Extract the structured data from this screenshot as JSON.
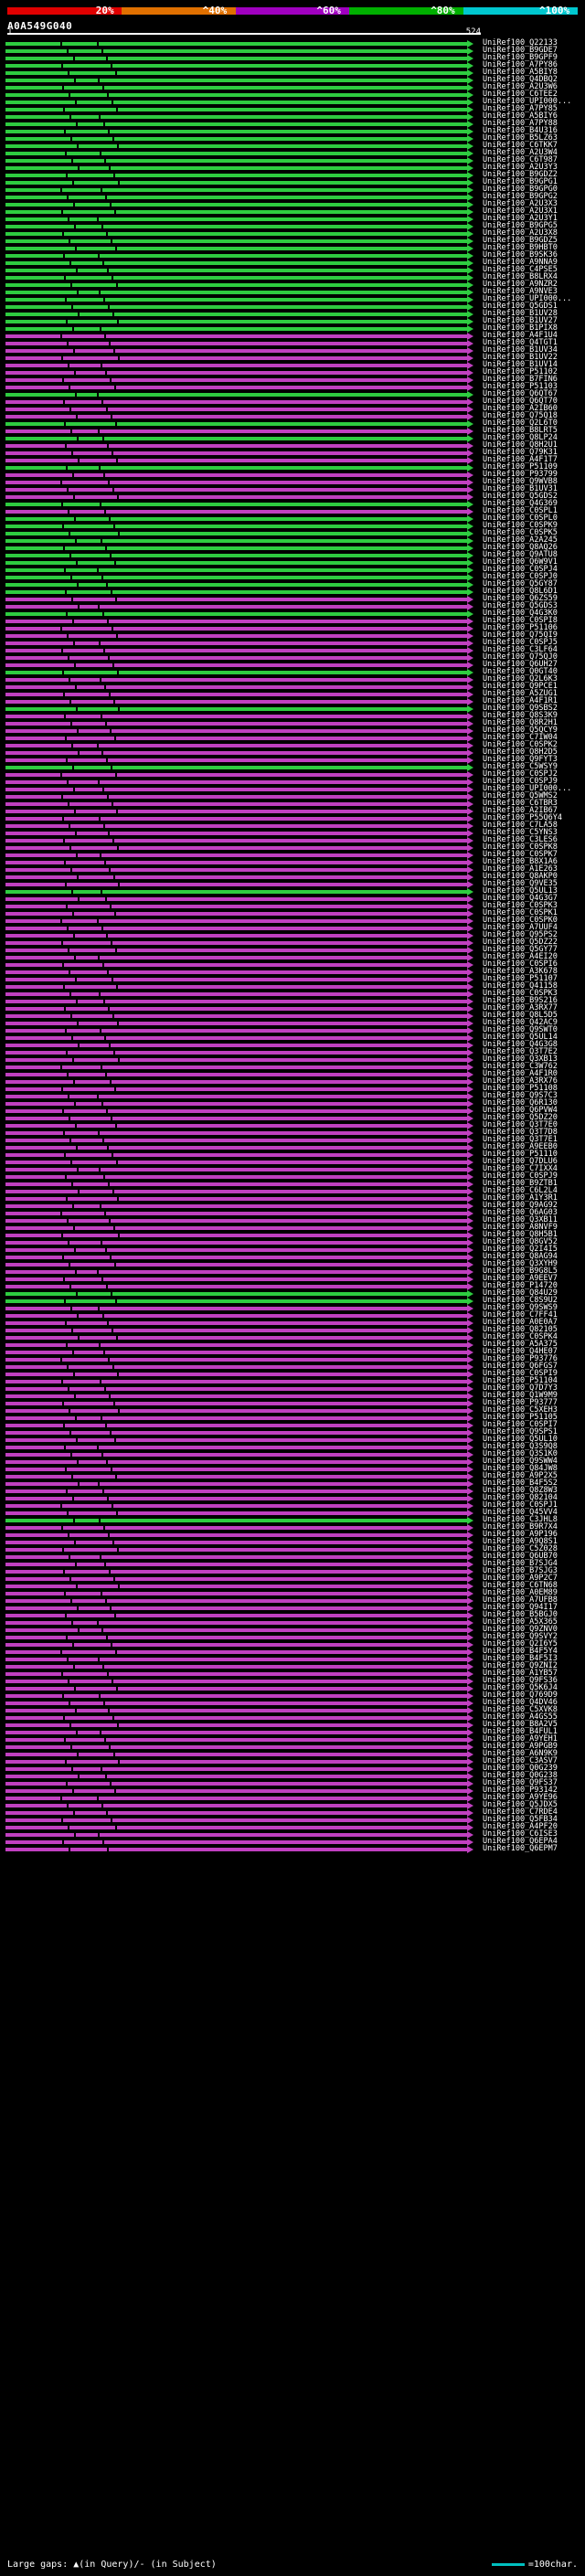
{
  "colors": {
    "seg1": "#e00000",
    "seg2": "#e07000",
    "seg3": "#a000c0",
    "seg4": "#00b000",
    "seg5": "#00c8d0",
    "bar_green": "#2ecc40",
    "bar_magenta": "#c040c0"
  },
  "legend": {
    "p20": "20%",
    "p40": "^40%",
    "p60": "^60%",
    "p80": "^80%",
    "p100": "^100%"
  },
  "query": {
    "name": "A0A549G040",
    "start": "1",
    "end": "524"
  },
  "footer": {
    "text": "Large gaps: ▲(in Query)/- (in Subject)",
    "scale_text": "=100char."
  },
  "hits": [
    "UniRef100_Q22133",
    "UniRef100_B9GDE7",
    "UniRef100_B9GPF9",
    "UniRef100_A7PY86",
    "UniRef100_A5BIY8",
    "UniRef100_Q4DBQ2",
    "UniRef100_A2U3W6",
    "UniRef100_C6TEE2",
    "UniRef100_UPI000...",
    "UniRef100_A7PY85",
    "UniRef100_A5BIY6",
    "UniRef100_A7PY88",
    "UniRef100_B4U316",
    "UniRef100_B5LZ63",
    "UniRef100_C6TKK7",
    "UniRef100_A2U3W4",
    "UniRef100_C6T987",
    "UniRef100_A2U3Y3",
    "UniRef100_B9GDZ2",
    "UniRef100_B9GPG1",
    "UniRef100_B9GPG0",
    "UniRef100_B9GPG2",
    "UniRef100_A2U3X3",
    "UniRef100_A2U3X1",
    "UniRef100_A2U3Y1",
    "UniRef100_B9GPG5",
    "UniRef100_A2U3X8",
    "UniRef100_B9GDZ5",
    "UniRef100_B9HBT0",
    "UniRef100_B9SK36",
    "UniRef100_A9NNA9",
    "UniRef100_C4PSE5",
    "UniRef100_B8LRX4",
    "UniRef100_A9NZR2",
    "UniRef100_A9NVE3",
    "UniRef100_UPI000...",
    "UniRef100_Q5GDS1",
    "UniRef100_B1UV28",
    "UniRef100_B1UV27",
    "UniRef100_B1PIX8",
    "UniRef100_A4F1U4",
    "UniRef100_Q4TGT1",
    "UniRef100_B1UV34",
    "UniRef100_B1UV22",
    "UniRef100_B1UV14",
    "UniRef100_P51102",
    "UniRef100_B7FIN6",
    "UniRef100_P51103",
    "UniRef100_Q6QT67",
    "UniRef100_Q6QT70",
    "UniRef100_A2IB60",
    "UniRef100_Q75Q18",
    "UniRef100_Q2L6T0",
    "UniRef100_B8LRT5",
    "UniRef100_Q8LP24",
    "UniRef100_Q8H2U1",
    "UniRef100_Q79K31",
    "UniRef100_A4F1T7",
    "UniRef100_P51109",
    "UniRef100_P93799",
    "UniRef100_Q9WVB8",
    "UniRef100_B1UV31",
    "UniRef100_Q5GDS2",
    "UniRef100_Q4G369",
    "UniRef100_C0SPL1",
    "UniRef100_C0SPL0",
    "UniRef100_C0SPK9",
    "UniRef100_C0SPK5",
    "UniRef100_A2A245",
    "UniRef100_Q8AQ26",
    "UniRef100_Q9ATU8",
    "UniRef100_Q6W9V1",
    "UniRef100_C0SPJ4",
    "UniRef100_C0SPJ0",
    "UniRef100_Q5GY87",
    "UniRef100_Q8L6D1",
    "UniRef100_Q6ZS59",
    "UniRef100_Q5GDS3",
    "UniRef100_Q4G3K0",
    "UniRef100_C0SPI8",
    "UniRef100_P51106",
    "UniRef100_Q75QI9",
    "UniRef100_C0SPJ5",
    "UniRef100_C3LF64",
    "UniRef100_Q75QJ0",
    "UniRef100_Q6UH27",
    "UniRef100_Q0GT40",
    "UniRef100_Q2L6K3",
    "UniRef100_Q9PCE1",
    "UniRef100_A5ZUG1",
    "UniRef100_A4F1R1",
    "UniRef100_Q9SBS2",
    "UniRef100_Q8S3K9",
    "UniRef100_Q8R2H1",
    "UniRef100_Q5QCY9",
    "UniRef100_C7IW04",
    "UniRef100_C0SPK2",
    "UniRef100_Q8H2D5",
    "UniRef100_Q9FYT3",
    "UniRef100_C5WSY9",
    "UniRef100_C0SPJ2",
    "UniRef100_C0SPJ9",
    "UniRef100_UPI000...",
    "UniRef100_Q5WMS2",
    "UniRef100_C6TBR3",
    "UniRef100_A2IB67",
    "UniRef100_P55Q6Y4",
    "UniRef100_C7LA58",
    "UniRef100_C5YNS3",
    "UniRef100_C3LES6",
    "UniRef100_C0SPK8",
    "UniRef100_C0SPK7",
    "UniRef100_B8X1A6",
    "UniRef100_A1E263",
    "UniRef100_Q8AKP0",
    "UniRef100_Q9VE35",
    "UniRef100_Q5UL13",
    "UniRef100_Q4G3G7",
    "UniRef100_C0SPK3",
    "UniRef100_C0SPK1",
    "UniRef100_C0SPK0",
    "UniRef100_A7UUF4",
    "UniRef100_Q95PS2",
    "UniRef100_Q5DZ22",
    "UniRef100_Q5GY77",
    "UniRef100_A4EI20",
    "UniRef100_C0SPI6",
    "UniRef100_A3K678",
    "UniRef100_P51107",
    "UniRef100_Q41158",
    "UniRef100_C0SPK3",
    "UniRef100_B9S216",
    "UniRef100_A3RX77",
    "UniRef100_Q8L5D5",
    "UniRef100_Q42AC9",
    "UniRef100_Q9SWT0",
    "UniRef100_Q5UL14",
    "UniRef100_Q4G3G8",
    "UniRef100_Q3T7E2",
    "UniRef100_Q3XB13",
    "UniRef100_C3W762",
    "UniRef100_A4F1R0",
    "UniRef100_A3RX76",
    "UniRef100_P51108",
    "UniRef100_Q9S7C3",
    "UniRef100_Q6R130",
    "UniRef100_Q6PVW4",
    "UniRef100_Q5DZ20",
    "UniRef100_Q3T7E0",
    "UniRef100_Q3T7D8",
    "UniRef100_Q3T7E1",
    "UniRef100_A9EEB0",
    "UniRef100_P51110",
    "UniRef100_Q7DLU6",
    "UniRef100_C7IXX4",
    "UniRef100_C0SPJ9",
    "UniRef100_B9ZTB1",
    "UniRef100_C6L2L4",
    "UniRef100_A1Y3R1",
    "UniRef100_Q9AG92",
    "UniRef100_Q6AG03",
    "UniRef100_Q3XB11",
    "UniRef100_A8NVF9",
    "UniRef100_Q8H5B1",
    "UniRef100_Q8GV52",
    "UniRef100_Q2I4I5",
    "UniRef100_Q8AG94",
    "UniRef100_Q3XYH9",
    "UniRef100_B9G8L5",
    "UniRef100_A9EEV7",
    "UniRef100_P14720",
    "UniRef100_Q84U29",
    "UniRef100_C8S9U2",
    "UniRef100_Q9SWS9",
    "UniRef100_C7FF41",
    "UniRef100_A0E0A7",
    "UniRef100_Q82105",
    "UniRef100_C0SPK4",
    "UniRef100_A5A375",
    "UniRef100_Q4HE07",
    "UniRef100_P93776",
    "UniRef100_Q6FGS7",
    "UniRef100_C0SPI9",
    "UniRef100_P51104",
    "UniRef100_Q7D7Y3",
    "UniRef100_Q1W9M9",
    "UniRef100_P93777",
    "UniRef100_C5XEH3",
    "UniRef100_P51105",
    "UniRef100_C0SPI7",
    "UniRef100_Q9SPS1",
    "UniRef100_Q5UL10",
    "UniRef100_Q3S9Q8",
    "UniRef100_Q3S1K0",
    "UniRef100_Q9SWW4",
    "UniRef100_Q84JW8",
    "UniRef100_A9P2X5",
    "UniRef100_B4F5S2",
    "UniRef100_Q8Z8W3",
    "UniRef100_Q82104",
    "UniRef100_C0SPJ1",
    "UniRef100_Q45VV4",
    "UniRef100_C3JHL8",
    "UniRef100_B9R7X4",
    "UniRef100_A9P196",
    "UniRef100_A9Q8S1",
    "UniRef100_C5Z028",
    "UniRef100_Q6UB70",
    "UniRef100_B7SJG4",
    "UniRef100_B7SJG3",
    "UniRef100_A9P2C7",
    "UniRef100_C6TN68",
    "UniRef100_A0EM89",
    "UniRef100_A7UFB8",
    "UniRef100_Q94I17",
    "UniRef100_B5BGJ0",
    "UniRef100_A5X365",
    "UniRef100_Q9ZNV0",
    "UniRef100_Q9SVY2",
    "UniRef100_Q2I6Y5",
    "UniRef100_B4F5Y4",
    "UniRef100_B4F5I3",
    "UniRef100_Q9ZNI2",
    "UniRef100_A1YB57",
    "UniRef100_Q9FS36",
    "UniRef100_Q5K6J4",
    "UniRef100_Q769D9",
    "UniRef100_Q4DV46",
    "UniRef100_C5XVK8",
    "UniRef100_A4GS55",
    "UniRef100_B8A2V5",
    "UniRef100_B4FUL1",
    "UniRef100_A9YEH1",
    "UniRef100_A9PGB9",
    "UniRef100_A6N9K9",
    "UniRef100_C3ASV7",
    "UniRef100_Q0G239",
    "UniRef100_Q0G238",
    "UniRef100_Q9FS37",
    "UniRef100_P93142",
    "UniRef100_A9YE96",
    "UniRef100_Q5JDX5",
    "UniRef100_C7RDE4",
    "UniRef100_Q5FB34",
    "UniRef100_A4PF20",
    "UniRef100_C6ISE3",
    "UniRef100_Q6EPA4",
    "UniRef100_Q6EPM7"
  ],
  "hit_colors": "GGGGGGGGGGGGGGGGGGGGGGGGGGGGGGGGGGGGGGGGMMMMMMMMGMMMGMGMMMGMMMMGMGGGGGGGGGGGMMGMMMMMMMGMMMMGMMMMMMMGMMMMMMMMMMMMMMMMGMMMMMMMMMMMMMMMMMMMMMMMMMMMMMMMMMMMMMMMMMMMMMMMMMMMMMMGGMMMMMMMMMMMMMMMMMMMMMMMMMMMMMGMMMMMMMMMMMMMMMMMMMMMMMMMMMMMMMMMMMMMMMMMMMMMMMMMMMMMMMMMMMMMMMMMMMMMMMMMMMMMMMMMMMMMMMMMMMMMMMMMMMMMMMMMMMMMMMMMMMMMMMMMMMM"
}
